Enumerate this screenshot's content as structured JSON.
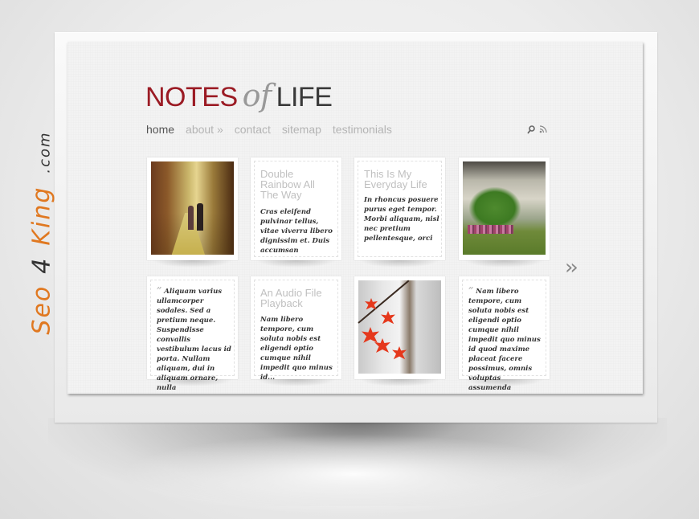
{
  "watermark": {
    "brand_a": "Seo",
    "brand_num": "4",
    "brand_b": "King",
    "suffix": ".com"
  },
  "site": {
    "logo": {
      "word1": "NOTES",
      "word2": "of",
      "word3": "LIFE"
    },
    "colors": {
      "logo_accent": "#9b1b24",
      "nav_active": "#555555",
      "nav_inactive": "#b4b4b4"
    },
    "nav": [
      {
        "label": "home",
        "active": true
      },
      {
        "label": "about »",
        "active": false
      },
      {
        "label": "contact",
        "active": false
      },
      {
        "label": "sitemap",
        "active": false
      },
      {
        "label": "testimonials",
        "active": false
      }
    ],
    "tools": {
      "search_icon": "⚲",
      "rss_icon": "rss"
    },
    "next_arrow": "››"
  },
  "cards": [
    {
      "type": "photo",
      "image": "couple walking down city street"
    },
    {
      "type": "post",
      "title": "Double Rainbow All The Way",
      "excerpt": "Cras eleifend pulvinar tellus, vitae viverra libero dignissim et. Duis accumsan"
    },
    {
      "type": "post",
      "title": "This Is My Everyday Life",
      "excerpt": "In rhoncus posuere purus eget tempor. Morbi aliquam, nisl nec pretium pellentesque, orci"
    },
    {
      "type": "photo",
      "image": "tree under cloudy sky with crowd"
    },
    {
      "type": "quote",
      "mark": "”",
      "excerpt": "Aliquam varius ullamcorper sodales. Sed a pretium neque. Suspendisse convallis vestibulum lacus id porta. Nullam aliquam, dui in aliquam ornare, nulla"
    },
    {
      "type": "post",
      "title": "An Audio File Playback",
      "excerpt": "Nam libero tempore, cum soluta nobis est eligendi optio cumque nihil impedit quo minus id..."
    },
    {
      "type": "photo",
      "image": "red maple leaves on branch"
    },
    {
      "type": "quote",
      "mark": "”",
      "excerpt": "Nam libero tempore, cum soluta nobis est eligendi optio cumque nihil impedit quo minus id quod maxime placeat facere possimus, omnis voluptas assumenda"
    }
  ]
}
